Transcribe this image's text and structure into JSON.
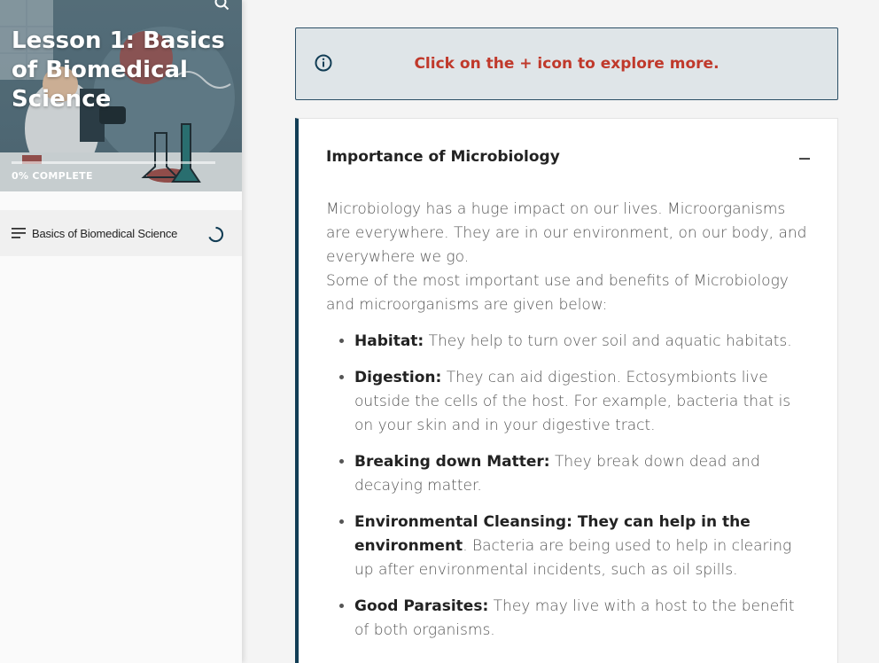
{
  "sidebar": {
    "lesson_title": "Lesson 1: Basics of Biomedical Science",
    "progress_text": "0% COMPLETE",
    "progress_value": 0,
    "nav_items": [
      {
        "label": "Basics of Biomedical Science",
        "icon": "menu-lines-icon",
        "status": "loading-spinner-icon"
      }
    ]
  },
  "main": {
    "info_banner": {
      "icon": "info-icon",
      "text": "Click on the + icon to explore more."
    },
    "accordion": {
      "title": "Importance of Microbiology",
      "toggle_icon": "minus-icon",
      "intro_1": "Microbiology has a huge impact on our lives. Microorganisms are everywhere. They are in our environment, on our body, and everywhere we go.",
      "intro_2": "Some of the most important use and benefits of Microbiology and microorganisms are given below:",
      "items": [
        {
          "term": "Habitat:",
          "desc": " They help to turn over soil and aquatic habitats."
        },
        {
          "term": "Digestion:",
          "desc": " They can aid digestion. Ectosymbionts live outside the cells of the host.  For example, bacteria that is on your skin and in your digestive tract."
        },
        {
          "term": "Breaking down Matter:",
          "desc": " They break down dead and decaying matter."
        },
        {
          "term": "Environmental Cleansing: They can help in the environment",
          "desc": ". Bacteria are being used to help in clearing up after environmental incidents, such as oil spills."
        },
        {
          "term": "Good Parasites:",
          "desc": " They may live with a host to the benefit of both organisms."
        }
      ]
    }
  },
  "colors": {
    "accent": "#123d55",
    "banner_text": "#c0392b",
    "banner_bg": "#dfe5e8"
  }
}
